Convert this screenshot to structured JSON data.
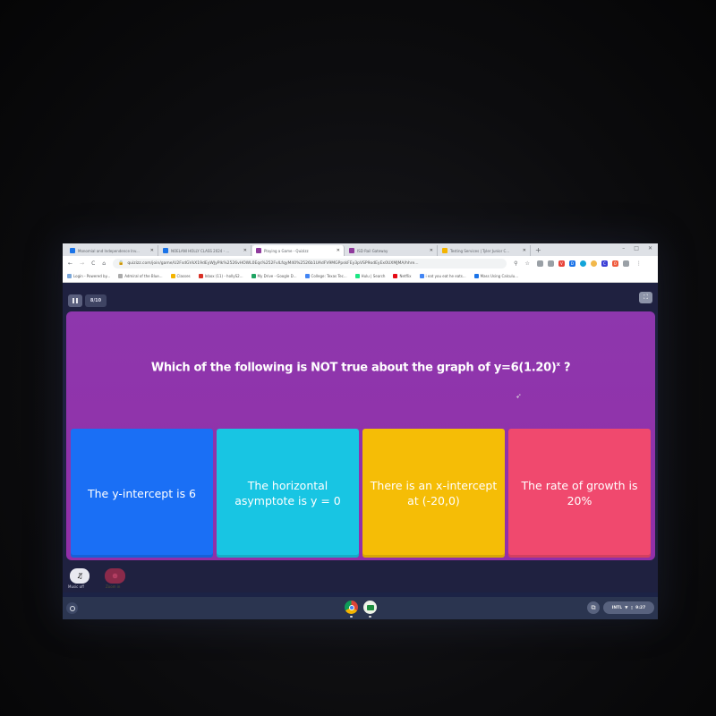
{
  "browser": {
    "tabs": [
      {
        "title": "Monomial and Independence Inv...",
        "favicon_color": "#1a73e8",
        "active": false
      },
      {
        "title": "NOELANI HOLLY CLASS 2024 - ...",
        "favicon_color": "#1a73e8",
        "active": false
      },
      {
        "title": "Playing a Game - Quizizz",
        "favicon_color": "#8e3a9c",
        "active": true
      },
      {
        "title": "ISD Rail Gateway",
        "favicon_color": "#8e3a9c",
        "active": false
      },
      {
        "title": "Testing Services | Tyler Junior C...",
        "favicon_color": "#f4b400",
        "active": false
      }
    ],
    "new_tab_label": "+",
    "window_controls": {
      "minimize": "–",
      "maximize": "□",
      "close": "✕"
    },
    "nav": {
      "back": "←",
      "forward": "→",
      "reload": "C",
      "home": "⌂"
    },
    "url": "quizizz.com/join/game/U2FsdGVkX19dEyWJyPlk%2526vHOWL0Eqs%252FvlLfqyM40%2526b1UAdFV9MGPpskFEy3pVSP9odEyEx0UXMJMA/hhre...",
    "omnibox_icons": [
      "location-icon",
      "star-icon"
    ],
    "extensions": [
      {
        "name": "reading-list-icon",
        "color": "#9aa0a6"
      },
      {
        "name": "extension-gray-icon",
        "color": "#9aa0a6"
      },
      {
        "name": "extension-red-icon",
        "color": "#e8453c",
        "glyph": "V"
      },
      {
        "name": "extension-blue-icon",
        "color": "#1a73e8",
        "glyph": "D"
      },
      {
        "name": "extension-teal-icon",
        "color": "#12a4d9",
        "glyph": ""
      },
      {
        "name": "extension-gold-icon",
        "color": "#f2b84b",
        "glyph": ""
      },
      {
        "name": "extension-navy-icon",
        "color": "#3b3fd6",
        "glyph": "C"
      },
      {
        "name": "extension-orange-icon",
        "color": "#ef5a3c",
        "glyph": "O"
      },
      {
        "name": "puzzle-icon",
        "color": "#9aa0a6",
        "glyph": ""
      }
    ],
    "bookmarks": [
      {
        "label": "Login - Powered by...",
        "color": "#7aa6d8"
      },
      {
        "label": "Admiral of the Blue...",
        "color": "#aaaaaa"
      },
      {
        "label": "Classes",
        "color": "#f4b400"
      },
      {
        "label": "Inbox (11) - hollyS2...",
        "color": "#d93025"
      },
      {
        "label": "My Drive - Google D...",
        "color": "#1fa463"
      },
      {
        "label": "College: Texas Tec...",
        "color": "#4285f4"
      },
      {
        "label": "Hulu | Search",
        "color": "#1ce783"
      },
      {
        "label": "Netflix",
        "color": "#e50914"
      },
      {
        "label": "i eat you eat he eats...",
        "color": "#4285f4"
      },
      {
        "label": "Mass Using Calculu...",
        "color": "#1a73e8"
      }
    ]
  },
  "quiz": {
    "question_counter": "8/10",
    "question_prefix": "Which of the following is NOT true about the graph of y=6(1.20)",
    "question_exponent": "x",
    "question_suffix": " ?",
    "options": [
      {
        "text": "The y-intercept is 6",
        "color": "#1a6ff5"
      },
      {
        "text": "The horizontal asymptote is y = 0",
        "color": "#18c5e3"
      },
      {
        "text": "There is an x-intercept at (-20,0)",
        "color": "#f5bd06"
      },
      {
        "text": "The rate of growth is 20%",
        "color": "#f0496e"
      }
    ],
    "card_color": "#8e37ad",
    "music_label": "Music off",
    "zoom_label": "Zoom in"
  },
  "shelf": {
    "apps": [
      "chrome-icon",
      "google-classroom-icon"
    ],
    "tray": {
      "ime": "INTL",
      "time": "9:27"
    }
  }
}
